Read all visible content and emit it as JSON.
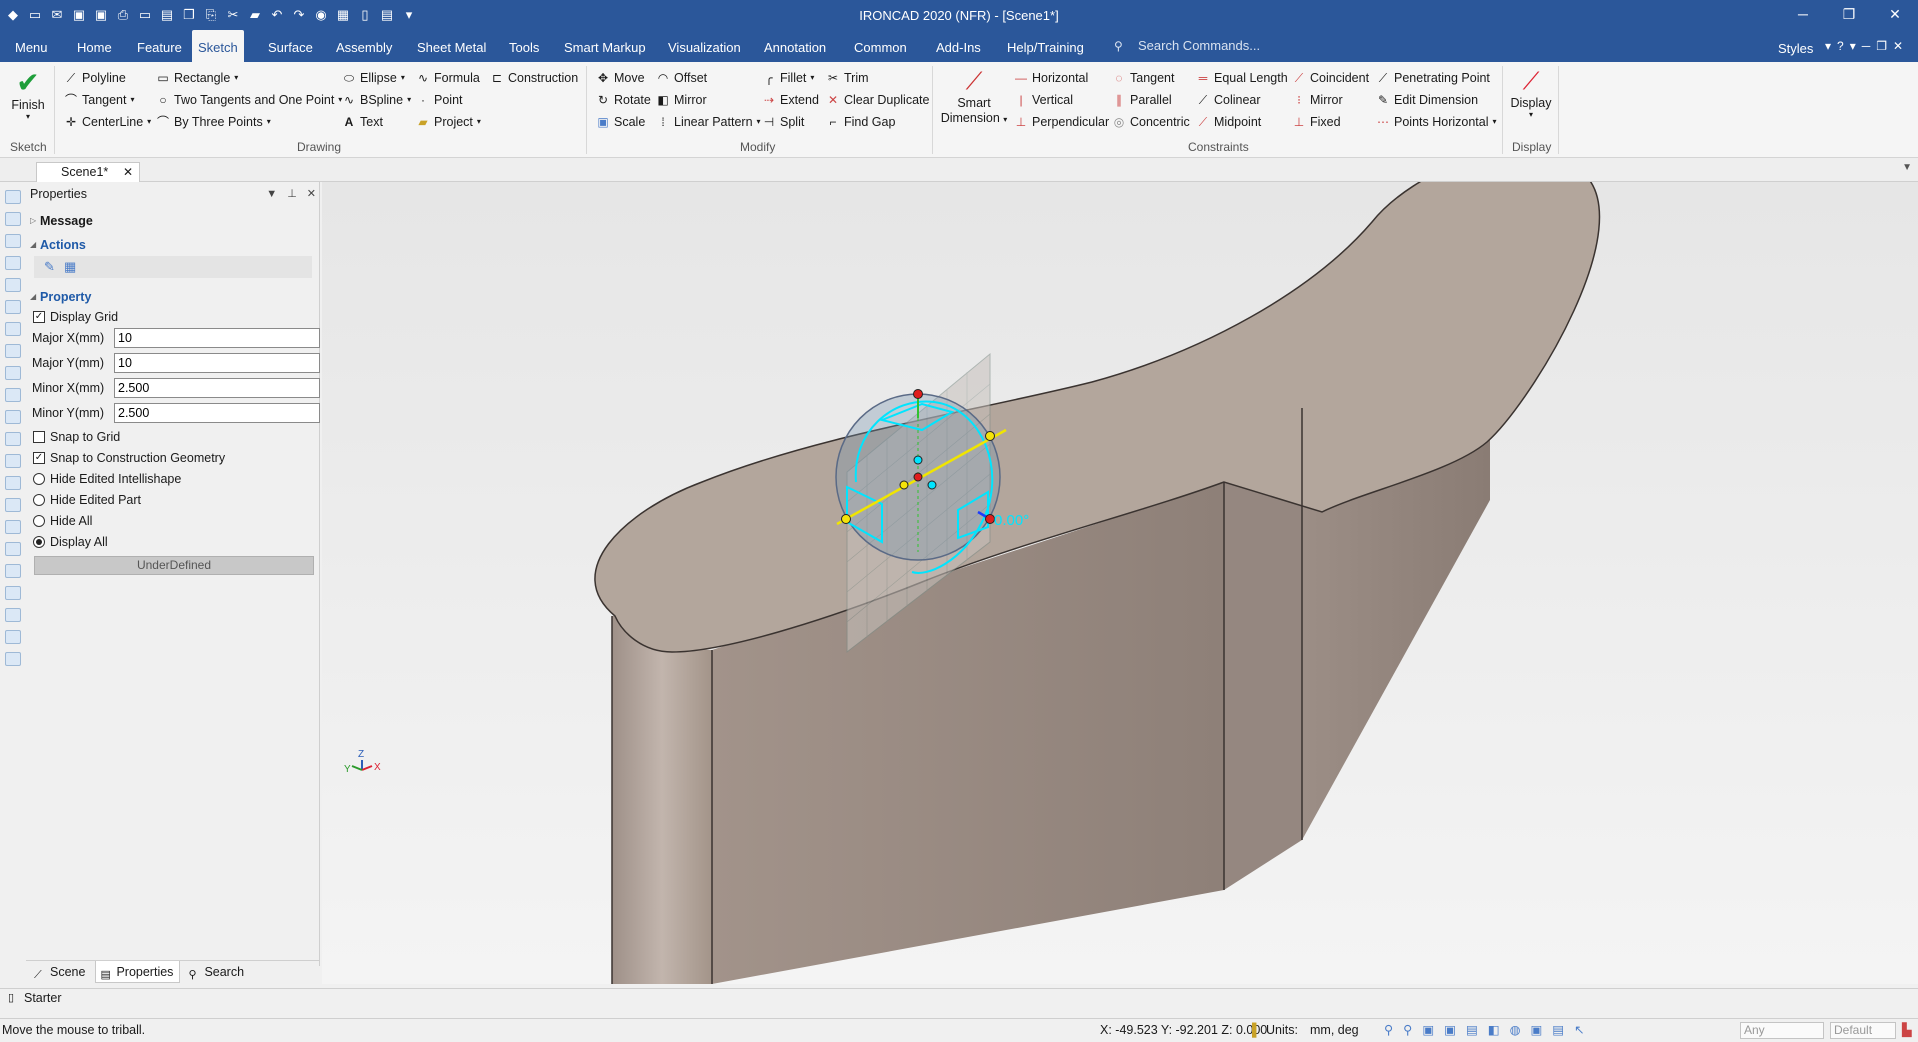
{
  "app": {
    "title": "IRONCAD 2020 (NFR) - [Scene1*]"
  },
  "menu_tabs": [
    "Menu",
    "Home",
    "Feature",
    "Sketch",
    "Surface",
    "Assembly",
    "Sheet Metal",
    "Tools",
    "Smart Markup",
    "Visualization",
    "Annotation",
    "Common",
    "Add-Ins",
    "Help/Training"
  ],
  "active_tab": "Sketch",
  "search": {
    "placeholder": "Search Commands..."
  },
  "styles_label": "Styles",
  "ribbon": {
    "sketch_group": {
      "finish": "Finish",
      "label": "Sketch"
    },
    "drawing_group": {
      "label": "Drawing",
      "polyline": "Polyline",
      "tangent": "Tangent",
      "centerline": "CenterLine",
      "rectangle": "Rectangle",
      "two_tangents": "Two Tangents and One Point",
      "by_three_points": "By Three Points",
      "ellipse": "Ellipse",
      "bspline": "BSpline",
      "text": "Text",
      "formula": "Formula",
      "point": "Point",
      "project": "Project",
      "construction": "Construction"
    },
    "modify_group": {
      "label": "Modify",
      "move": "Move",
      "rotate": "Rotate",
      "scale": "Scale",
      "offset": "Offset",
      "mirror": "Mirror",
      "linear_pattern": "Linear Pattern",
      "fillet": "Fillet",
      "extend": "Extend",
      "split": "Split",
      "trim": "Trim",
      "clear_duplicate": "Clear Duplicate",
      "find_gap": "Find Gap"
    },
    "constraints_group": {
      "label": "Constraints",
      "smart_dimension_1": "Smart",
      "smart_dimension_2": "Dimension",
      "horizontal": "Horizontal",
      "vertical": "Vertical",
      "perpendicular": "Perpendicular",
      "tangent": "Tangent",
      "parallel": "Parallel",
      "concentric": "Concentric",
      "equal_length": "Equal Length",
      "colinear": "Colinear",
      "midpoint": "Midpoint",
      "coincident": "Coincident",
      "mirror": "Mirror",
      "fixed": "Fixed",
      "penetrating_point": "Penetrating Point",
      "edit_dimension": "Edit Dimension",
      "points_horizontal": "Points Horizontal"
    },
    "display_group": {
      "display": "Display",
      "label": "Display"
    }
  },
  "doc_tab": {
    "label": "Scene1*"
  },
  "properties_panel": {
    "title": "Properties",
    "sections": {
      "message": "Message",
      "actions": "Actions",
      "property": "Property"
    },
    "display_grid": {
      "label": "Display Grid",
      "checked": true
    },
    "major_x": {
      "label": "Major X(mm)",
      "value": "10"
    },
    "major_y": {
      "label": "Major Y(mm)",
      "value": "10"
    },
    "minor_x": {
      "label": "Minor X(mm)",
      "value": "2.500"
    },
    "minor_y": {
      "label": "Minor Y(mm)",
      "value": "2.500"
    },
    "snap_to_grid": {
      "label": "Snap to Grid",
      "checked": false
    },
    "snap_to_construction": {
      "label": "Snap to Construction Geometry",
      "checked": true
    },
    "hide_edited_intellishape": "Hide Edited Intellishape",
    "hide_edited_part": "Hide Edited Part",
    "hide_all": "Hide All",
    "display_all": "Display All",
    "underdefined": "UnderDefined",
    "bottom_tabs": [
      "Scene",
      "Properties",
      "Search"
    ]
  },
  "viewport": {
    "angle_label": "0.00°",
    "axis_labels": {
      "z": "Z",
      "x": "X",
      "y": "Y"
    }
  },
  "catalog_tab": "Starter",
  "status": {
    "message": "Move the mouse to triball.",
    "coords": "X: -49.523 Y: -92.201 Z: 0.000",
    "units_label": "Units:",
    "units_value": "mm, deg",
    "filter": "Any",
    "style": "Default"
  },
  "colors": {
    "accent": "#2b579a",
    "sketch": "#00e5ff",
    "part": "#b3a69c"
  }
}
